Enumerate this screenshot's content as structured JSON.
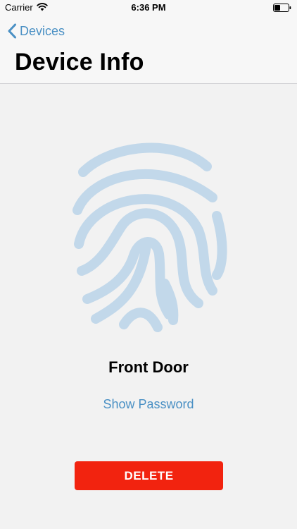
{
  "status_bar": {
    "carrier": "Carrier",
    "time": "6:36 PM",
    "wifi_icon": "wifi-icon",
    "battery_icon": "battery-icon"
  },
  "nav": {
    "back_label": "Devices",
    "back_icon": "chevron-left-icon",
    "title": "Device Info"
  },
  "device": {
    "icon": "fingerprint-icon",
    "name": "Front Door",
    "show_password_label": "Show Password",
    "delete_label": "DELETE"
  },
  "colors": {
    "accent": "#4a90c4",
    "fingerprint": "#c2d8ea",
    "delete": "#f2230f",
    "background": "#f2f2f2",
    "nav_background": "#f7f7f7"
  }
}
